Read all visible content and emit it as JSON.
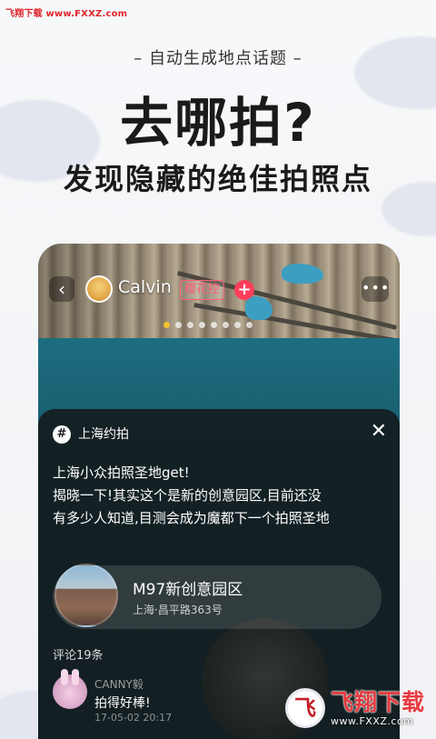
{
  "watermark": {
    "top_left": "飞翔下载 www.FXXZ.com",
    "badge_big": "飞翔下载",
    "badge_small": "www.FXXZ.com",
    "logo_glyph": "飞"
  },
  "hero": {
    "subtitle": "– 自动生成地点话题 –",
    "title": "去哪拍?",
    "tagline": "发现隐藏的绝佳拍照点"
  },
  "profile_bar": {
    "back_glyph": "‹",
    "username": "Calvin",
    "tag": "樱花控",
    "follow_glyph": "+",
    "more_glyph": "•••",
    "carousel_count": 8,
    "carousel_active": 0
  },
  "sheet": {
    "topic_glyph": "#",
    "topic": "上海约拍",
    "close_glyph": "✕",
    "post_lines": [
      "上海小众拍照圣地get!",
      "揭晓一下!其实这个是新的创意园区,目前还没",
      "有多少人知道,目测会成为魔都下一个拍照圣地"
    ],
    "location": {
      "name": "M97新创意园区",
      "address": "上海·昌平路363号"
    },
    "comment_count": "评论19条",
    "comment": {
      "user": "CANNY毅",
      "text": "拍得好棒!",
      "time": "17-05-02 20:17"
    }
  },
  "colors": {
    "accent_pink": "#ff3e5b",
    "tag_pink": "#ff5e72",
    "active_dot": "#f2c230"
  }
}
